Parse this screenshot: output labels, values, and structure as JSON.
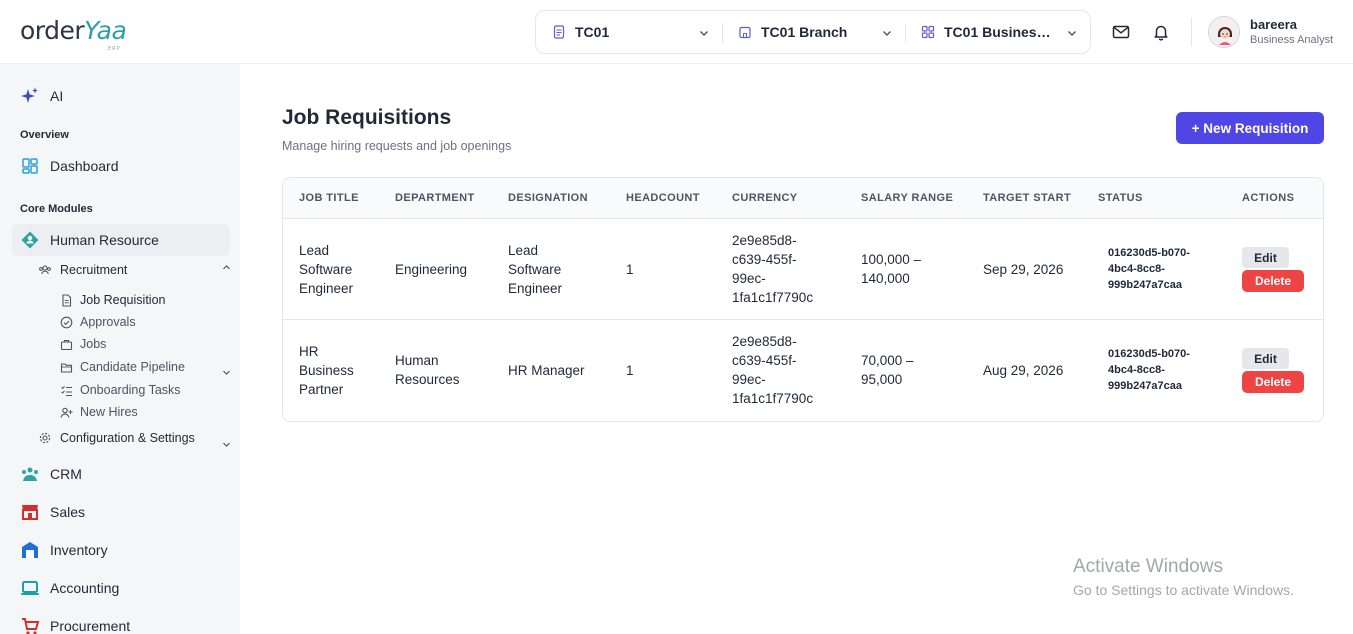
{
  "brand": {
    "logo_part1": "order",
    "logo_part2": "Yaa",
    "logo_tag": "ERP"
  },
  "header": {
    "company_selector": "TC01",
    "branch_selector": "TC01 Branch",
    "business_selector": "TC01 Business ...",
    "user": {
      "name": "bareera",
      "role": "Business Analyst"
    }
  },
  "sidebar": {
    "ai_label": "AI",
    "overview_heading": "Overview",
    "dashboard_label": "Dashboard",
    "core_modules_heading": "Core Modules",
    "human_resource_label": "Human Resource",
    "recruitment_label": "Recruitment",
    "recruitment_items": [
      "Job Requisition",
      "Approvals",
      "Jobs",
      "Candidate Pipeline",
      "Onboarding Tasks",
      "New Hires"
    ],
    "config_label": "Configuration & Settings",
    "modules": [
      "CRM",
      "Sales",
      "Inventory",
      "Accounting",
      "Procurement"
    ]
  },
  "page": {
    "title": "Job Requisitions",
    "subtitle": "Manage hiring requests and job openings",
    "new_button": "+ New Requisition"
  },
  "table": {
    "columns": [
      "JOB TITLE",
      "DEPARTMENT",
      "DESIGNATION",
      "HEADCOUNT",
      "CURRENCY",
      "SALARY RANGE",
      "TARGET START",
      "STATUS",
      "ACTIONS"
    ],
    "edit_label": "Edit",
    "delete_label": "Delete",
    "rows": [
      {
        "job_title": [
          "Lead",
          "Software",
          "Engineer"
        ],
        "department": [
          "Engineering"
        ],
        "designation": [
          "Lead",
          "Software",
          "Engineer"
        ],
        "headcount": "1",
        "currency": [
          "2e9e85d8-",
          "c639-455f-",
          "99ec-",
          "1fa1c1f7790c"
        ],
        "salary_range": [
          "100,000 –",
          "140,000"
        ],
        "target_start": "Sep 29, 2026",
        "status": [
          "016230d5-b070-",
          "4bc4-8cc8-",
          "999b247a7caa"
        ]
      },
      {
        "job_title": [
          "HR",
          "Business",
          "Partner"
        ],
        "department": [
          "Human",
          "Resources"
        ],
        "designation": [
          "HR Manager"
        ],
        "headcount": "1",
        "currency": [
          "2e9e85d8-",
          "c639-455f-",
          "99ec-",
          "1fa1c1f7790c"
        ],
        "salary_range": [
          "70,000 –",
          "95,000"
        ],
        "target_start": "Aug 29, 2026",
        "status": [
          "016230d5-b070-",
          "4bc4-8cc8-",
          "999b247a7caa"
        ]
      }
    ]
  },
  "watermark": {
    "title": "Activate Windows",
    "subtitle": "Go to Settings to activate Windows."
  },
  "colors": {
    "primary": "#4f46e5",
    "danger": "#ef4444",
    "brand_teal": "#2f9fa6",
    "sidebar_bg": "#f5f6f8"
  }
}
